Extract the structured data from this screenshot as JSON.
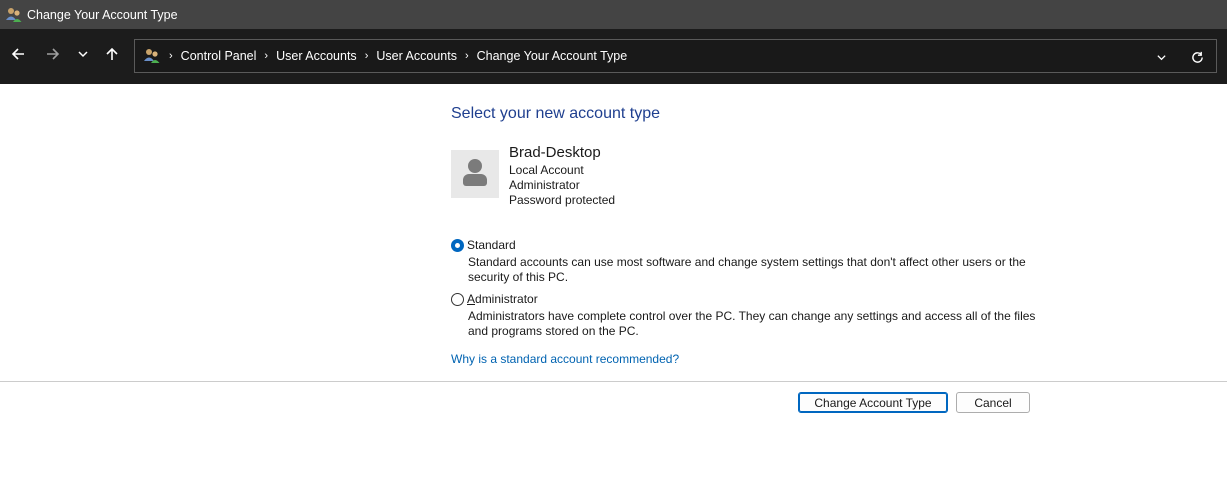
{
  "window": {
    "title": "Change Your Account Type"
  },
  "breadcrumb": {
    "items": [
      "Control Panel",
      "User Accounts",
      "User Accounts",
      "Change Your Account Type"
    ]
  },
  "main": {
    "heading": "Select your new account type",
    "account": {
      "name": "Brad-Desktop",
      "type": "Local Account",
      "role": "Administrator",
      "password_status": "Password protected"
    },
    "options": [
      {
        "label_prefix": "",
        "label_access": "",
        "label_rest": "Standard",
        "description": "Standard accounts can use most software and change system settings that don't affect other users or the security of this PC.",
        "selected": true
      },
      {
        "label_prefix": "",
        "label_access": "A",
        "label_rest": "dministrator",
        "description": "Administrators have complete control over the PC. They can change any settings and access all of the files and programs stored on the PC.",
        "selected": false
      }
    ],
    "help_link": "Why is a standard account recommended?"
  },
  "buttons": {
    "change": "Change Account Type",
    "cancel": "Cancel"
  },
  "colors": {
    "accent": "#0067c0",
    "heading": "#1f3f8f",
    "link": "#0063b1"
  }
}
